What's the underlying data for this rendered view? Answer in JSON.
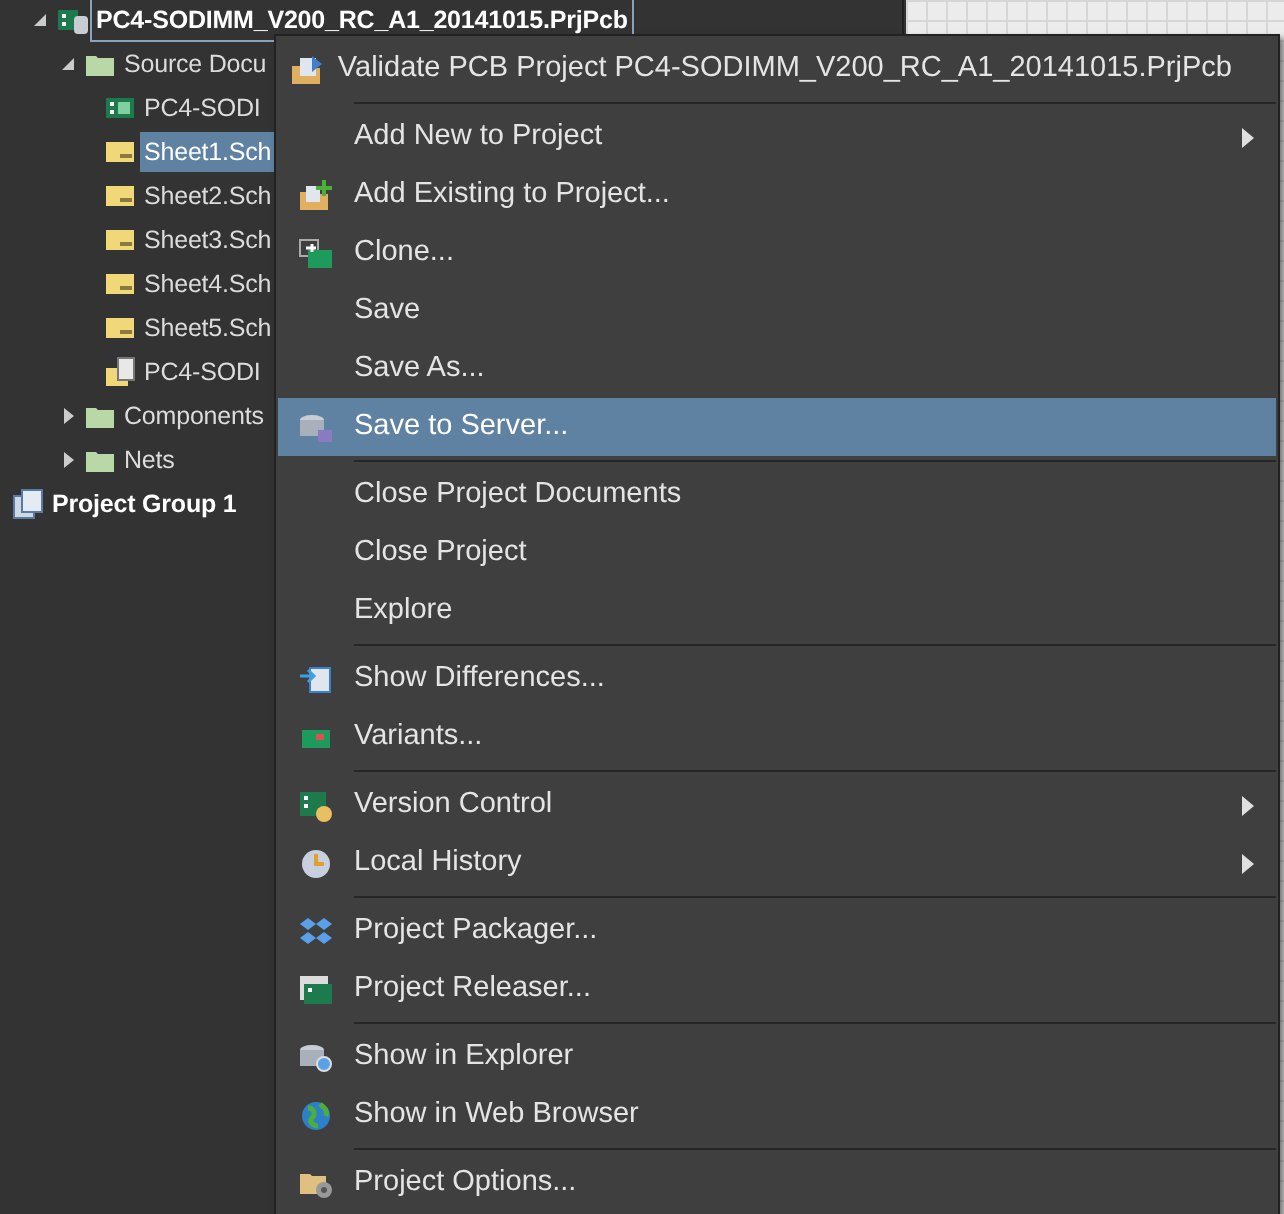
{
  "tree": [
    {
      "label": "PC4-SODIMM_V200_RC_A1_20141015.PrjPcb",
      "kind": "project",
      "expanded": true,
      "selected": false,
      "focused": true,
      "children": [
        {
          "label": "Source Docu",
          "kind": "folder",
          "expanded": true,
          "selected": false,
          "children": [
            {
              "label": "PC4-SODI",
              "kind": "pcb",
              "selected": false
            },
            {
              "label": "Sheet1.Sch",
              "kind": "sch",
              "selected": true
            },
            {
              "label": "Sheet2.Sch",
              "kind": "sch",
              "selected": false
            },
            {
              "label": "Sheet3.Sch",
              "kind": "sch",
              "selected": false
            },
            {
              "label": "Sheet4.Sch",
              "kind": "sch",
              "selected": false
            },
            {
              "label": "Sheet5.Sch",
              "kind": "sch",
              "selected": false
            },
            {
              "label": "PC4-SODI",
              "kind": "doc",
              "selected": false
            }
          ]
        },
        {
          "label": "Components",
          "kind": "folder",
          "expanded": false,
          "selected": false
        },
        {
          "label": "Nets",
          "kind": "folder",
          "expanded": false,
          "selected": false
        }
      ]
    },
    {
      "label": "Project Group 1",
      "kind": "group",
      "selected": false
    }
  ],
  "context_menu": [
    {
      "kind": "item",
      "label": "Validate PCB Project PC4-SODIMM_V200_RC_A1_20141015.PrjPcb",
      "selected": false,
      "submenu": false
    },
    {
      "kind": "separator"
    },
    {
      "kind": "item",
      "label": "Add New to Project",
      "selected": false,
      "submenu": true
    },
    {
      "kind": "item",
      "label": "Add Existing to Project...",
      "selected": false,
      "submenu": false
    },
    {
      "kind": "item",
      "label": "Clone...",
      "selected": false,
      "submenu": false
    },
    {
      "kind": "item",
      "label": "Save",
      "selected": false,
      "submenu": false
    },
    {
      "kind": "item",
      "label": "Save As...",
      "selected": false,
      "submenu": false
    },
    {
      "kind": "item",
      "label": "Save to Server...",
      "selected": true,
      "submenu": false
    },
    {
      "kind": "separator"
    },
    {
      "kind": "item",
      "label": "Close Project Documents",
      "selected": false,
      "submenu": false
    },
    {
      "kind": "item",
      "label": "Close Project",
      "selected": false,
      "submenu": false
    },
    {
      "kind": "item",
      "label": "Explore",
      "selected": false,
      "submenu": false
    },
    {
      "kind": "separator"
    },
    {
      "kind": "item",
      "label": "Show Differences...",
      "selected": false,
      "submenu": false
    },
    {
      "kind": "item",
      "label": "Variants...",
      "selected": false,
      "submenu": false
    },
    {
      "kind": "separator"
    },
    {
      "kind": "item",
      "label": "Version Control",
      "selected": false,
      "submenu": true
    },
    {
      "kind": "item",
      "label": "Local History",
      "selected": false,
      "submenu": true
    },
    {
      "kind": "separator"
    },
    {
      "kind": "item",
      "label": "Project Packager...",
      "selected": false,
      "submenu": false
    },
    {
      "kind": "item",
      "label": "Project Releaser...",
      "selected": false,
      "submenu": false
    },
    {
      "kind": "separator"
    },
    {
      "kind": "item",
      "label": "Show in Explorer",
      "selected": false,
      "submenu": false
    },
    {
      "kind": "item",
      "label": "Show in Web Browser",
      "selected": false,
      "submenu": false
    },
    {
      "kind": "separator"
    },
    {
      "kind": "item",
      "label": "Project Options...",
      "selected": false,
      "submenu": false
    }
  ]
}
